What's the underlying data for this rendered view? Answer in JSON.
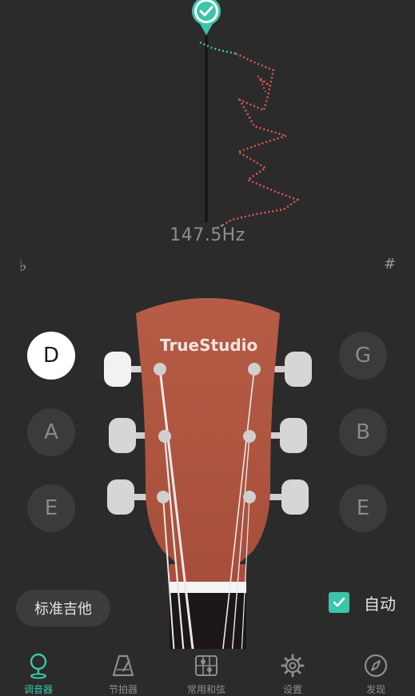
{
  "tuner": {
    "frequency": "147.5Hz",
    "flat_symbol": "♭",
    "sharp_symbol": "#"
  },
  "strings": {
    "left": [
      {
        "note": "D",
        "active": true
      },
      {
        "note": "A",
        "active": false
      },
      {
        "note": "E",
        "active": false
      }
    ],
    "right": [
      {
        "note": "G",
        "active": false
      },
      {
        "note": "B",
        "active": false
      },
      {
        "note": "E",
        "active": false
      }
    ]
  },
  "headstock": {
    "brand_text": "TrueStudio"
  },
  "controls": {
    "preset_label": "标准吉他",
    "auto_label": "自动",
    "auto_checked": true
  },
  "tabs": [
    {
      "label": "调音器",
      "icon": "tuner-pin-icon",
      "active": true
    },
    {
      "label": "节拍器",
      "icon": "metronome-icon",
      "active": false
    },
    {
      "label": "常用和弦",
      "icon": "chord-icon",
      "active": false
    },
    {
      "label": "设置",
      "icon": "gear-icon",
      "active": false
    },
    {
      "label": "发现",
      "icon": "compass-icon",
      "active": false
    }
  ],
  "colors": {
    "accent": "#3cc5a8",
    "pitch_trace": "#e35555",
    "headstock": "#b35a45"
  }
}
